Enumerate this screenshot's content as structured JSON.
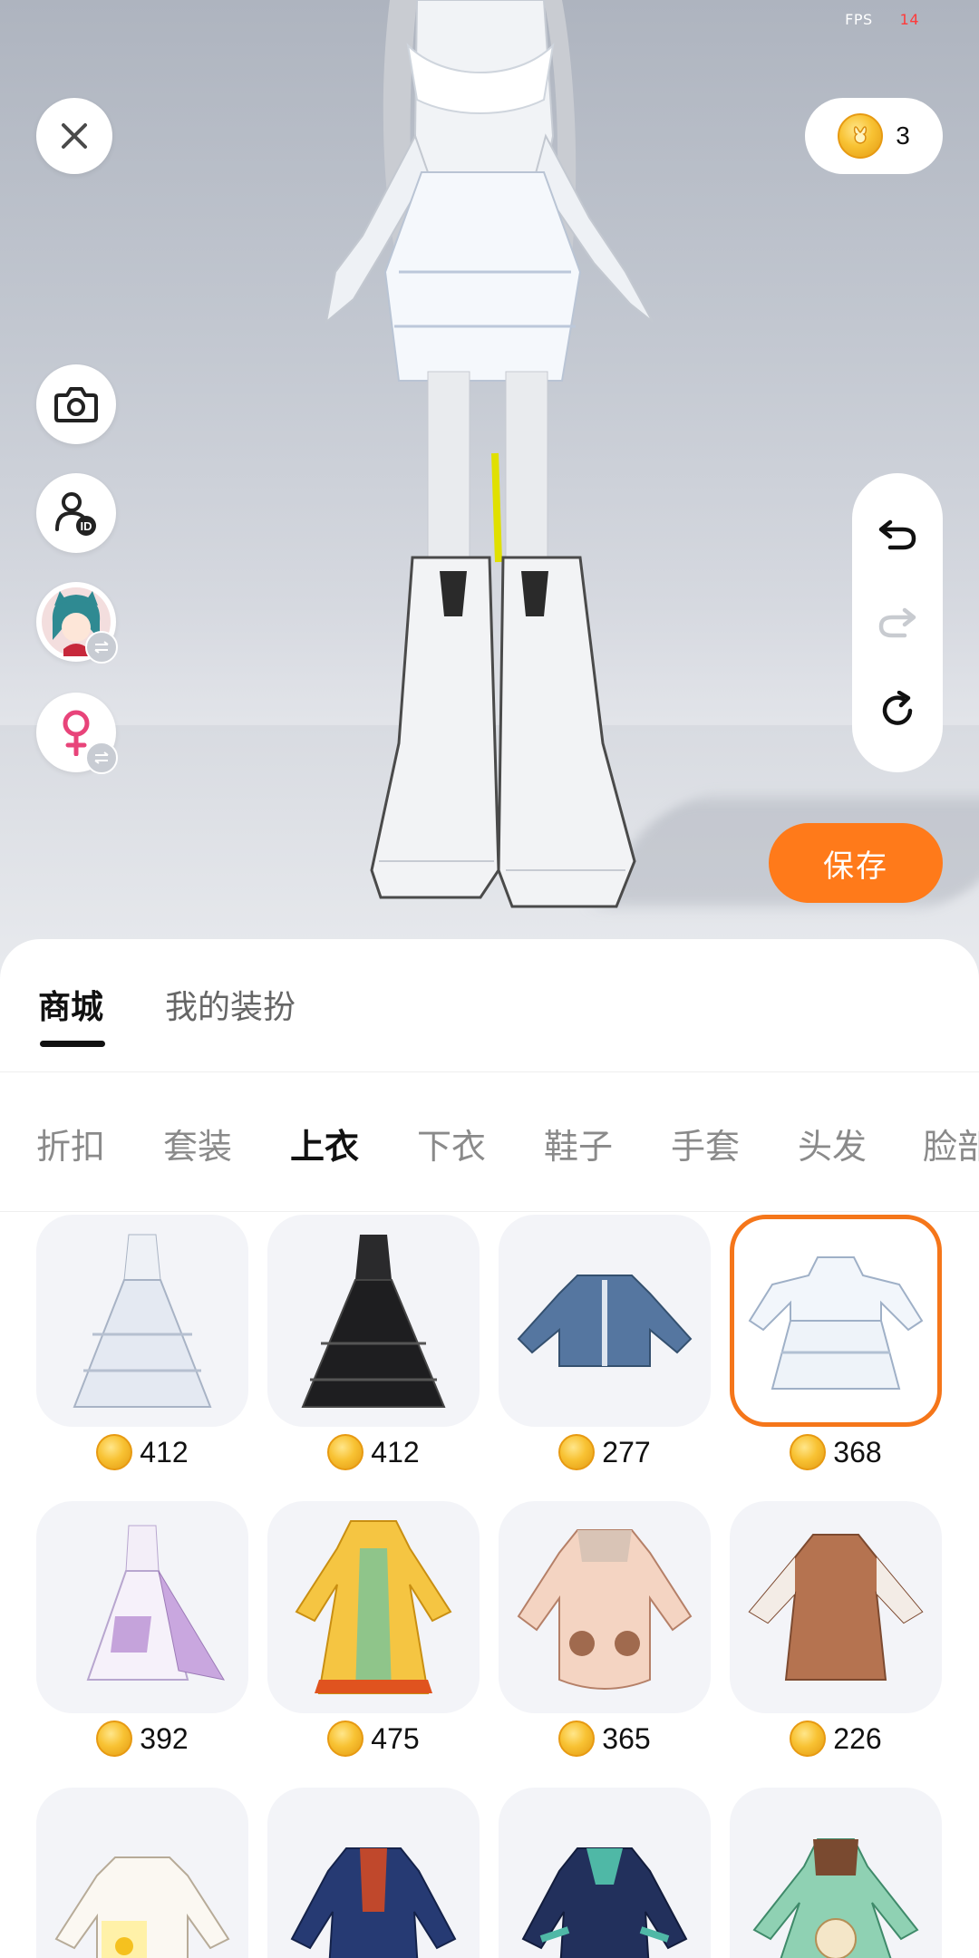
{
  "hud": {
    "fps_label": "FPS",
    "fps_value": "14",
    "coin_balance": "3"
  },
  "left_tools": [
    {
      "name": "camera-icon"
    },
    {
      "name": "user-id-icon"
    },
    {
      "name": "avatar-switch"
    },
    {
      "name": "female-gender-icon"
    }
  ],
  "right_tools": [
    "undo-icon",
    "redo-icon",
    "reset-icon"
  ],
  "save_label": "保存",
  "top_tabs": [
    "商城",
    "我的装扮"
  ],
  "categories": [
    "折扣",
    "套装",
    "上衣",
    "下衣",
    "鞋子",
    "手套",
    "头发",
    "脸部"
  ],
  "active_category": "上衣",
  "items": [
    {
      "icon": "white-ball-gown",
      "price": "412"
    },
    {
      "icon": "black-ball-gown",
      "price": "412"
    },
    {
      "icon": "blue-jacket",
      "price": "277"
    },
    {
      "icon": "white-lace-dress",
      "price": "368",
      "selected": true
    },
    {
      "icon": "lilac-cape-dress",
      "price": "392"
    },
    {
      "icon": "golden-hanfu-dress",
      "price": "475"
    },
    {
      "icon": "peach-bear-coat",
      "price": "365"
    },
    {
      "icon": "brown-sweater-dress",
      "price": "226"
    },
    {
      "icon": "duck-hoodie",
      "price": ""
    },
    {
      "icon": "navy-embroidered-coat",
      "price": ""
    },
    {
      "icon": "navy-teal-coat",
      "price": ""
    },
    {
      "icon": "green-lolita-dress",
      "price": ""
    }
  ],
  "colors": {
    "accent": "#ff7a1a",
    "selected_border": "#f5761a",
    "coin": "#f8c233"
  }
}
